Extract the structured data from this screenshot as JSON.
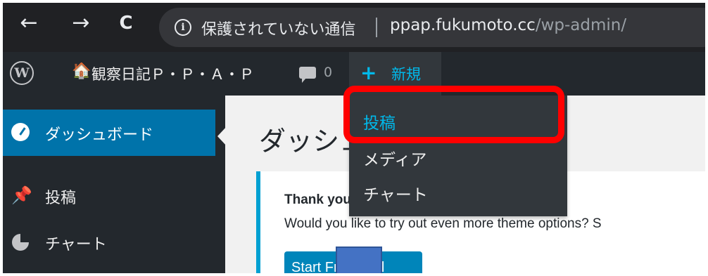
{
  "browser": {
    "back_glyph": "←",
    "forward_glyph": "→",
    "reload_glyph": "C",
    "info_glyph": "i",
    "security_text": "保護されていない通信",
    "url_host": "ppap.fukumoto.cc",
    "url_path": "/wp-admin/"
  },
  "admin_bar": {
    "wp_logo_glyph": "W",
    "home_glyph": "🏠",
    "site_name": "観察日記Ｐ・Ｐ・Ａ・Ｐ",
    "comment_count": "0",
    "plus_glyph": "+",
    "new_label": "新規"
  },
  "new_menu": {
    "items": [
      {
        "label": "投稿"
      },
      {
        "label": "メディア"
      },
      {
        "label": "チャート"
      }
    ]
  },
  "sidebar": {
    "items": [
      {
        "label": "ダッシュボード",
        "icon": "dashboard-icon"
      },
      {
        "label": "投稿",
        "icon": "pin-icon",
        "glyph": "📌"
      },
      {
        "label": "チャート",
        "icon": "pie-chart-icon"
      }
    ]
  },
  "content": {
    "page_title": "ダッシュボード",
    "notice_title": "Thank you for installing Twenty Seventeen p",
    "notice_text": "Would you like to try out even more theme options? S",
    "trial_button": "Start Free Trial"
  },
  "colors": {
    "admin_bar": "#23282d",
    "accent": "#0073aa",
    "link_blue": "#00b9eb",
    "highlight": "#ff0000"
  }
}
